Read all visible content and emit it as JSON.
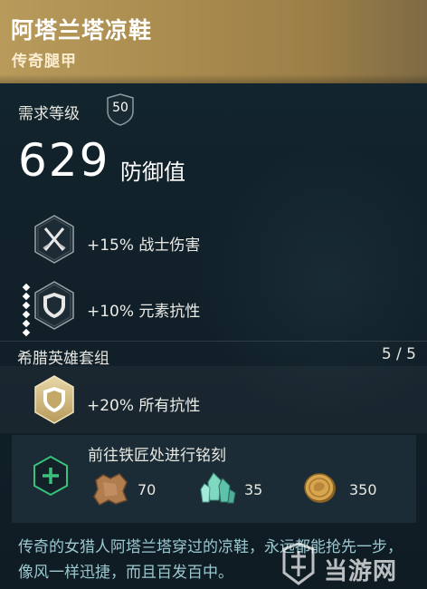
{
  "item": {
    "name": "阿塔兰塔凉鞋",
    "type": "传奇腿甲"
  },
  "requirement": {
    "label": "需求等级",
    "level": "50"
  },
  "defense": {
    "value": "629",
    "label": "防御值"
  },
  "perks": [
    {
      "text": "+15% 战士伤害",
      "icon": "crossed-blades-icon"
    },
    {
      "text": "+10% 元素抗性",
      "icon": "shield-icon"
    }
  ],
  "set": {
    "label": "希腊英雄套组",
    "count": "5 / 5",
    "bonus_text": "+20% 所有抗性",
    "bonus_icon": "gold-shield-icon"
  },
  "engraving": {
    "title": "前往铁匠处进行铭刻",
    "resources": [
      {
        "icon": "leather-icon",
        "amount": "70"
      },
      {
        "icon": "crystal-icon",
        "amount": "35"
      },
      {
        "icon": "ancient-coin-icon",
        "amount": "350"
      }
    ]
  },
  "description": "传奇的女猎人阿塔兰塔穿过的凉鞋，永远都能抢先一步，像风一样迅捷，而且百发百中。",
  "watermark": {
    "text": "当游网"
  },
  "colors": {
    "header_gold": "#b89a5b",
    "description_teal": "#9bc7cf",
    "add_green": "#39c07a"
  }
}
